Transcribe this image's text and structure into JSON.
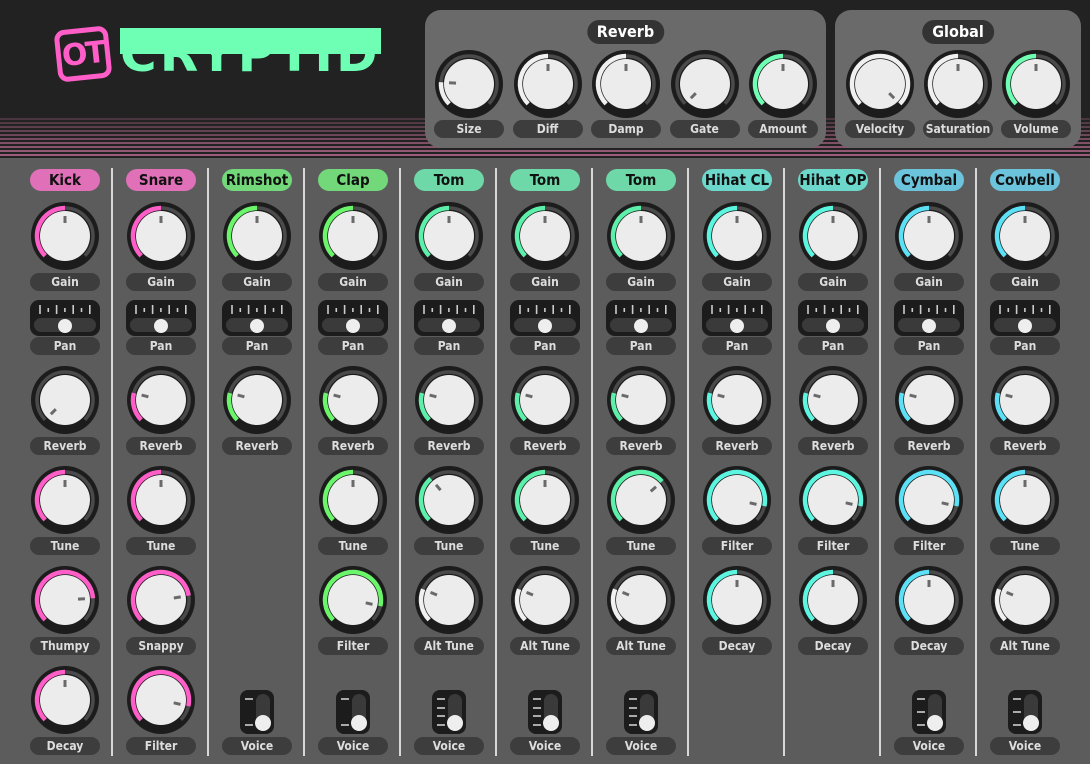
{
  "app": {
    "logo_badge": "OT",
    "logo_name": "CRYPTID",
    "colors": {
      "header_bg": "#222222",
      "body_bg": "#5c5c5c",
      "stripe": "#a2607f",
      "logo_pink": "#ff5ec8",
      "logo_green": "#6effb4",
      "knob_face": "#ececec",
      "knob_ring": "#1c1c1c",
      "label_bg": "#3d3d3d"
    }
  },
  "reverb_panel": {
    "title": "Reverb",
    "knobs": [
      {
        "label": "Size",
        "value": 0.18,
        "color": "#f0f0f0"
      },
      {
        "label": "Diff",
        "value": 0.5,
        "color": "#f0f0f0"
      },
      {
        "label": "Damp",
        "value": 0.5,
        "color": "#f0f0f0"
      },
      {
        "label": "Gate",
        "value": 0.0,
        "color": "#f0f0f0"
      },
      {
        "label": "Amount",
        "value": 0.5,
        "color": "#6effb4"
      }
    ]
  },
  "global_panel": {
    "title": "Global",
    "knobs": [
      {
        "label": "Velocity",
        "value": 1.0,
        "color": "#f0f0f0"
      },
      {
        "label": "Saturation",
        "value": 0.5,
        "color": "#f0f0f0"
      },
      {
        "label": "Volume",
        "value": 0.5,
        "color": "#6effb4"
      }
    ]
  },
  "channels": [
    {
      "name": "Kick",
      "color": "#e070b8",
      "accent": "#ff5ec8",
      "pan": 0.5,
      "knobs": [
        {
          "label": "Gain",
          "value": 0.5
        },
        {
          "label": "Reverb",
          "value": 0.0
        },
        {
          "label": "Tune",
          "value": 0.5
        },
        {
          "label": "Thumpy",
          "value": 0.82
        },
        {
          "label": "Decay",
          "value": 0.5
        }
      ],
      "voice": null
    },
    {
      "name": "Snare",
      "color": "#e070b8",
      "accent": "#ff5ec8",
      "pan": 0.5,
      "knobs": [
        {
          "label": "Gain",
          "value": 0.5
        },
        {
          "label": "Reverb",
          "value": 0.22
        },
        {
          "label": "Tune",
          "value": 0.5
        },
        {
          "label": "Snappy",
          "value": 0.8
        },
        {
          "label": "Filter",
          "value": 0.88
        }
      ],
      "voice": null
    },
    {
      "name": "Rimshot",
      "color": "#72d87a",
      "accent": "#6af56a",
      "pan": 0.5,
      "knobs": [
        {
          "label": "Gain",
          "value": 0.5
        },
        {
          "label": "Reverb",
          "value": 0.22
        }
      ],
      "voice": {
        "label": "Voice",
        "positions": 2,
        "selected": 1
      }
    },
    {
      "name": "Clap",
      "color": "#72d87a",
      "accent": "#6af56a",
      "pan": 0.5,
      "knobs": [
        {
          "label": "Gain",
          "value": 0.5
        },
        {
          "label": "Reverb",
          "value": 0.22
        },
        {
          "label": "Tune",
          "value": 0.5
        },
        {
          "label": "Filter",
          "value": 0.88
        }
      ],
      "voice": {
        "label": "Voice",
        "positions": 2,
        "selected": 1
      }
    },
    {
      "name": "Tom",
      "color": "#6ed8a8",
      "accent": "#5cf0aa",
      "pan": 0.5,
      "knobs": [
        {
          "label": "Gain",
          "value": 0.5
        },
        {
          "label": "Reverb",
          "value": 0.22
        },
        {
          "label": "Tune",
          "value": 0.35
        },
        {
          "label": "Alt Tune",
          "value": 0.25,
          "white": true
        }
      ],
      "voice": {
        "label": "Voice",
        "positions": 4,
        "selected": 3
      }
    },
    {
      "name": "Tom",
      "color": "#6ed8a8",
      "accent": "#5cf0aa",
      "pan": 0.5,
      "knobs": [
        {
          "label": "Gain",
          "value": 0.5
        },
        {
          "label": "Reverb",
          "value": 0.22
        },
        {
          "label": "Tune",
          "value": 0.5
        },
        {
          "label": "Alt Tune",
          "value": 0.25,
          "white": true
        }
      ],
      "voice": {
        "label": "Voice",
        "positions": 4,
        "selected": 3
      }
    },
    {
      "name": "Tom",
      "color": "#6ed8a8",
      "accent": "#5cf0aa",
      "pan": 0.5,
      "knobs": [
        {
          "label": "Gain",
          "value": 0.5
        },
        {
          "label": "Reverb",
          "value": 0.22
        },
        {
          "label": "Tune",
          "value": 0.68
        },
        {
          "label": "Alt Tune",
          "value": 0.25,
          "white": true
        }
      ],
      "voice": {
        "label": "Voice",
        "positions": 4,
        "selected": 3
      }
    },
    {
      "name": "Hihat CL",
      "color": "#6cd8cc",
      "accent": "#5cf5e0",
      "pan": 0.5,
      "knobs": [
        {
          "label": "Gain",
          "value": 0.5
        },
        {
          "label": "Reverb",
          "value": 0.22
        },
        {
          "label": "Filter",
          "value": 0.88
        },
        {
          "label": "Decay",
          "value": 0.5
        }
      ],
      "voice": null
    },
    {
      "name": "Hihat OP",
      "color": "#6cd8cc",
      "accent": "#5cf5e0",
      "pan": 0.5,
      "knobs": [
        {
          "label": "Gain",
          "value": 0.5
        },
        {
          "label": "Reverb",
          "value": 0.22
        },
        {
          "label": "Filter",
          "value": 0.88
        },
        {
          "label": "Decay",
          "value": 0.5
        }
      ],
      "voice": null
    },
    {
      "name": "Cymbal",
      "color": "#6cc4dc",
      "accent": "#5ce0f5",
      "pan": 0.5,
      "knobs": [
        {
          "label": "Gain",
          "value": 0.5
        },
        {
          "label": "Reverb",
          "value": 0.22
        },
        {
          "label": "Filter",
          "value": 0.88
        },
        {
          "label": "Decay",
          "value": 0.5
        }
      ],
      "voice": {
        "label": "Voice",
        "positions": 3,
        "selected": 2
      }
    },
    {
      "name": "Cowbell",
      "color": "#6cc4dc",
      "accent": "#5ce0f5",
      "pan": 0.5,
      "knobs": [
        {
          "label": "Gain",
          "value": 0.5
        },
        {
          "label": "Reverb",
          "value": 0.22
        },
        {
          "label": "Tune",
          "value": 0.5
        },
        {
          "label": "Alt Tune",
          "value": 0.25,
          "white": true
        }
      ],
      "voice": {
        "label": "Voice",
        "positions": 3,
        "selected": 2
      }
    }
  ],
  "pan_label": "Pan"
}
